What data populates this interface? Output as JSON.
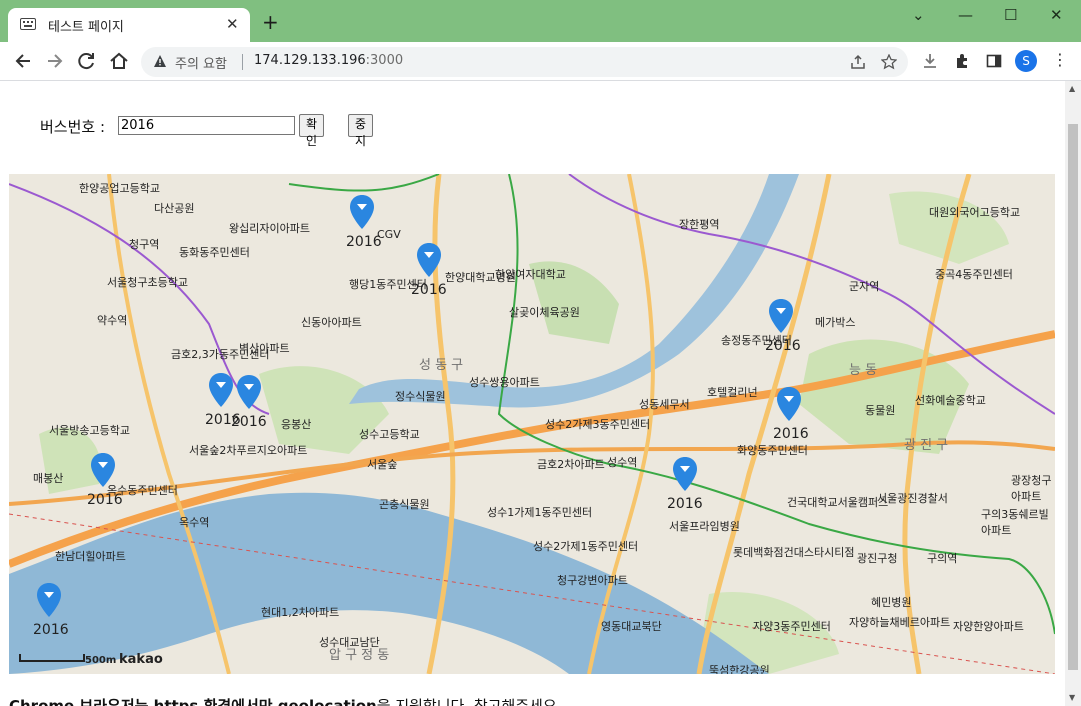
{
  "browser": {
    "tab_title": "테스트 페이지",
    "security_label": "주의 요함",
    "url_host": "174.129.133.196",
    "url_port": ":3000",
    "profile_initial": "S"
  },
  "form": {
    "bus_label": "버스번호 :",
    "bus_value": "2016",
    "confirm_label": "확인",
    "stop_label": "중지"
  },
  "map": {
    "scale_label": "500m",
    "brand": "kakao",
    "markers": [
      {
        "label": "2016"
      },
      {
        "label": "2016"
      },
      {
        "label": "2016"
      },
      {
        "label": "2016"
      },
      {
        "label": "2016"
      },
      {
        "label": "2016"
      },
      {
        "label": "2016"
      },
      {
        "label": "2016"
      },
      {
        "label": "2016"
      },
      {
        "label": "2016"
      }
    ],
    "places": [
      "한양공업고등학교",
      "다산공원",
      "왕십리자이아파트",
      "청구역",
      "동화동주민센터",
      "서울청구초등학교",
      "약수역",
      "금호2,3가동주민센터",
      "벽산아파트",
      "행당1동주민센터",
      "한양대학교병원",
      "한양여자대학교",
      "살곶이체육공원",
      "신동아아파트",
      "성동구",
      "성수쌍용아파트",
      "정수식물원",
      "성수2가제3동주민센터",
      "성수고등학교",
      "서울숲",
      "금호2차아파트",
      "성수역",
      "서울숲2차푸르지오아파트",
      "응봉산",
      "서울방송고등학교",
      "매봉산",
      "옥수동주민센터",
      "옥수역",
      "한남더힐아파트",
      "곤충식물원",
      "성수1가제1동주민센터",
      "성수2가제1동주민센터",
      "청구강변아파트",
      "현대1,2차아파트",
      "성수대교남단",
      "영동대교북단",
      "장한평역",
      "송정동주민센터",
      "호텔컬리넌",
      "성동세무서",
      "화양동주민센터",
      "서울프라임병원",
      "건국대학교서울캠퍼스",
      "롯데백화점건대스타시티점",
      "자양3동주민센터",
      "군자역",
      "메가박스",
      "대원외국어고등학교",
      "중곡4동주민센터",
      "능동",
      "동물원",
      "선화예술중학교",
      "광진구",
      "서울광진경찰서",
      "광장청구아파트",
      "구의3동쉐르빌아파트",
      "광진구청",
      "구의역",
      "혜민병원",
      "자양하늘채베르아파트",
      "자양한양아파트",
      "뚝섬한강공원",
      "CGV"
    ]
  },
  "status_message": {
    "bold_part": "Chrome 브라우저는 https 환경에서만 geolocation",
    "rest": "을 지원합니다. 참고해주세요."
  }
}
